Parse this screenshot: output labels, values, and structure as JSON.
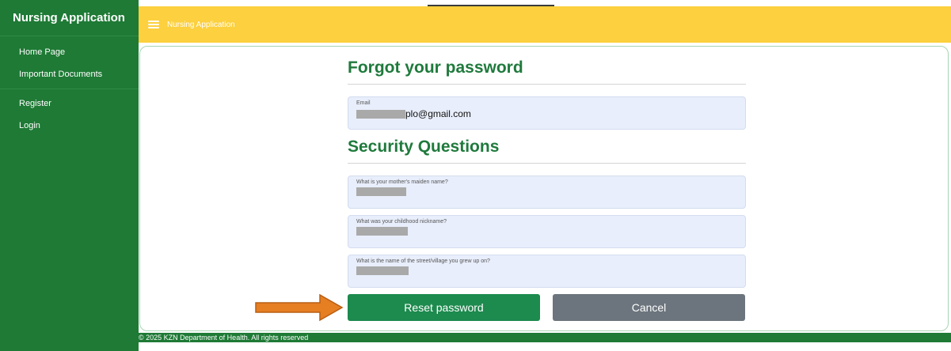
{
  "sidebar": {
    "title": "Nursing Application",
    "group1": [
      {
        "label": "Home Page"
      },
      {
        "label": "Important Documents"
      }
    ],
    "group2": [
      {
        "label": "Register"
      },
      {
        "label": "Login"
      }
    ]
  },
  "topbar": {
    "menu_icon": "hamburger-icon",
    "title": "Nursing Application"
  },
  "form": {
    "heading": "Forgot your password",
    "email": {
      "label": "Email",
      "value": "plo@gmail.com"
    },
    "security_heading": "Security Questions",
    "questions": [
      {
        "label": "What is your mother's maiden name?"
      },
      {
        "label": "What was your childhood nickname?"
      },
      {
        "label": "What is the name of the street/village you grew up on?"
      }
    ],
    "reset_label": "Reset password",
    "cancel_label": "Cancel"
  },
  "footer": {
    "text": "© 2025 KZN Department of Health. All rights reserved"
  },
  "colors": {
    "sidebar": "#1e7a35",
    "topbar": "#fcd03e",
    "heading": "#1f7a3c",
    "reset_button": "#1d8a4e",
    "cancel_button": "#6c757d",
    "field_bg": "#e8eefb",
    "annotation_arrow": "#e67e22"
  }
}
